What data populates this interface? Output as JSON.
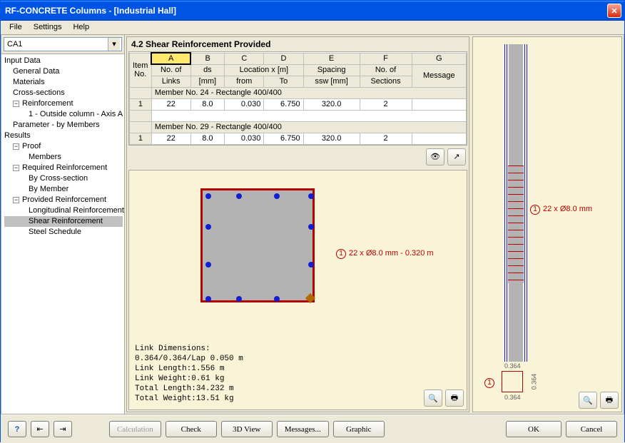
{
  "window": {
    "title": "RF-CONCRETE Columns - [Industrial Hall]"
  },
  "menu": {
    "file": "File",
    "settings": "Settings",
    "help": "Help"
  },
  "case_combo": "CA1",
  "tree": {
    "input_data": "Input Data",
    "general_data": "General Data",
    "materials": "Materials",
    "cross_sections": "Cross-sections",
    "reinforcement": "Reinforcement",
    "reinf_item": "1 - Outside column - Axis A",
    "parameter": "Parameter - by Members",
    "results": "Results",
    "proof": "Proof",
    "members": "Members",
    "req_reinf": "Required Reinforcement",
    "by_cs": "By Cross-section",
    "by_member": "By Member",
    "prov_reinf": "Provided Reinforcement",
    "long_reinf": "Longitudinal Reinforcement",
    "shear_reinf": "Shear Reinforcement",
    "steel_sched": "Steel Schedule"
  },
  "panel_title": "4.2 Shear Reinforcement Provided",
  "grid": {
    "col_letters": [
      "A",
      "B",
      "C",
      "D",
      "E",
      "F",
      "G"
    ],
    "hdr_item": "Item",
    "hdr_no": "No.",
    "hdr_links": "No. of",
    "hdr_links2": "Links",
    "hdr_ds": "ds",
    "hdr_ds_unit": "[mm]",
    "hdr_loc": "Location x [m]",
    "hdr_from": "from",
    "hdr_to": "To",
    "hdr_spacing": "Spacing",
    "hdr_spacing_unit": "ssw [mm]",
    "hdr_nsect": "No. of",
    "hdr_nsect2": "Sections",
    "hdr_msg": "Message",
    "group1": "Member No. 24 - Rectangle 400/400",
    "group2": "Member No. 29 - Rectangle 400/400",
    "row": {
      "id": "1",
      "links": "22",
      "ds": "8.0",
      "from": "0.030",
      "to": "6.750",
      "spacing": "320.0",
      "nsect": "2",
      "msg": ""
    }
  },
  "section_label": "22 x Ø8.0 mm - 0.320 m",
  "elev_label": "22 x Ø8.0 mm",
  "mini_dims": {
    "w": "0.364",
    "h": "0.364"
  },
  "link_dims": "Link Dimensions:\n0.364/0.364/Lap 0.050 m\nLink Length:1.556 m\nLink Weight:0.61 kg\nTotal Length:34.232 m\nTotal Weight:13.51 kg",
  "buttons": {
    "calc": "Calculation",
    "check": "Check",
    "view3d": "3D View",
    "messages": "Messages...",
    "graphic": "Graphic",
    "ok": "OK",
    "cancel": "Cancel"
  }
}
